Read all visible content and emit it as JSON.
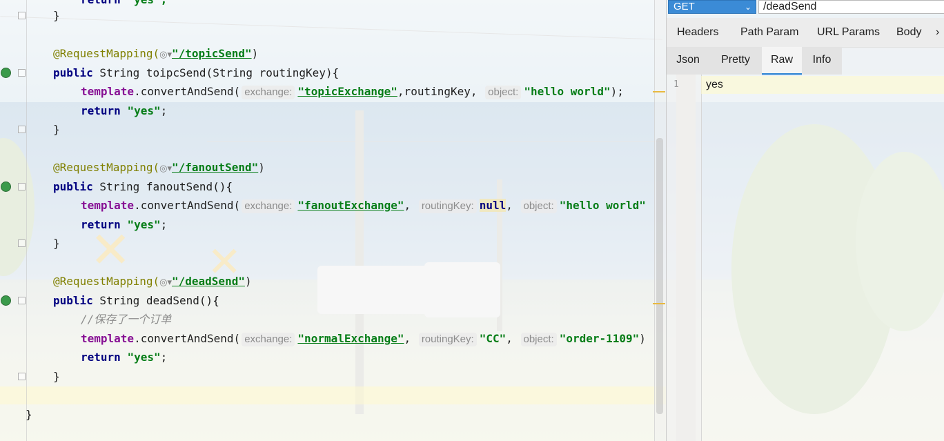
{
  "editor": {
    "lines": {
      "l01": {
        "ret": "return",
        "str": "\"yes\";"
      },
      "l02": {
        "brace": "}"
      },
      "l03": {
        "ann": "@RequestMapping(",
        "web": "◎▾",
        "path": "\"/topicSend\"",
        "close": ")"
      },
      "l04": {
        "kw": "public",
        "rest": " String toipcSend(String routingKey){"
      },
      "l05": {
        "field": "template",
        "call": ".convertAndSend(",
        "h1": "exchange:",
        "s1": "\"topicExchange\"",
        "mid": ",routingKey, ",
        "h2": "object:",
        "s2": "\"hello world\"",
        "end": ");"
      },
      "l06": {
        "ret": "return",
        "str": "\"yes\"",
        "end": ";"
      },
      "l07": {
        "brace": "}"
      },
      "l08": {
        "ann": "@RequestMapping(",
        "web": "◎▾",
        "path": "\"/fanoutSend\"",
        "close": ")"
      },
      "l09": {
        "kw": "public",
        "rest": " String fanoutSend(){"
      },
      "l10": {
        "field": "template",
        "call": ".convertAndSend(",
        "h1": "exchange:",
        "s1": "\"fanoutExchange\"",
        "sep1": ", ",
        "h2": "routingKey:",
        "nullv": "null",
        "sep2": ", ",
        "h3": "object:",
        "s3": "\"hello world\""
      },
      "l11": {
        "ret": "return",
        "str": "\"yes\"",
        "end": ";"
      },
      "l12": {
        "brace": "}"
      },
      "l13": {
        "ann": "@RequestMapping(",
        "web": "◎▾",
        "path": "\"/deadSend\"",
        "close": ")"
      },
      "l14": {
        "kw": "public",
        "rest": " String deadSend(){"
      },
      "l15": {
        "comment": "//保存了一个订单"
      },
      "l16": {
        "field": "template",
        "call": ".convertAndSend(",
        "h1": "exchange:",
        "s1": "\"normalExchange\"",
        "sep1": ", ",
        "h2": "routingKey:",
        "s2": "\"CC\"",
        "sep2": ", ",
        "h3": "object:",
        "s3": "\"order-1109\"",
        "end": ")"
      },
      "l17": {
        "ret": "return",
        "str": "\"yes\"",
        "end": ";"
      },
      "l18": {
        "brace": "}"
      },
      "l19": {
        "brace": "}"
      }
    }
  },
  "rest": {
    "method": "GET",
    "method_chevron": "⌄",
    "url": "/deadSend",
    "request_tabs": [
      "Headers",
      "Path Param",
      "URL Params",
      "Body",
      "›"
    ],
    "response_tabs": [
      "Json",
      "Pretty",
      "Raw",
      "Info"
    ],
    "active_response_tab": "Raw",
    "response_line_number": "1",
    "response_body": "yes"
  },
  "colors": {
    "accent": "#3b8bd6",
    "keyword": "#000080",
    "string": "#067d17",
    "annotation": "#808000",
    "field": "#871094"
  }
}
